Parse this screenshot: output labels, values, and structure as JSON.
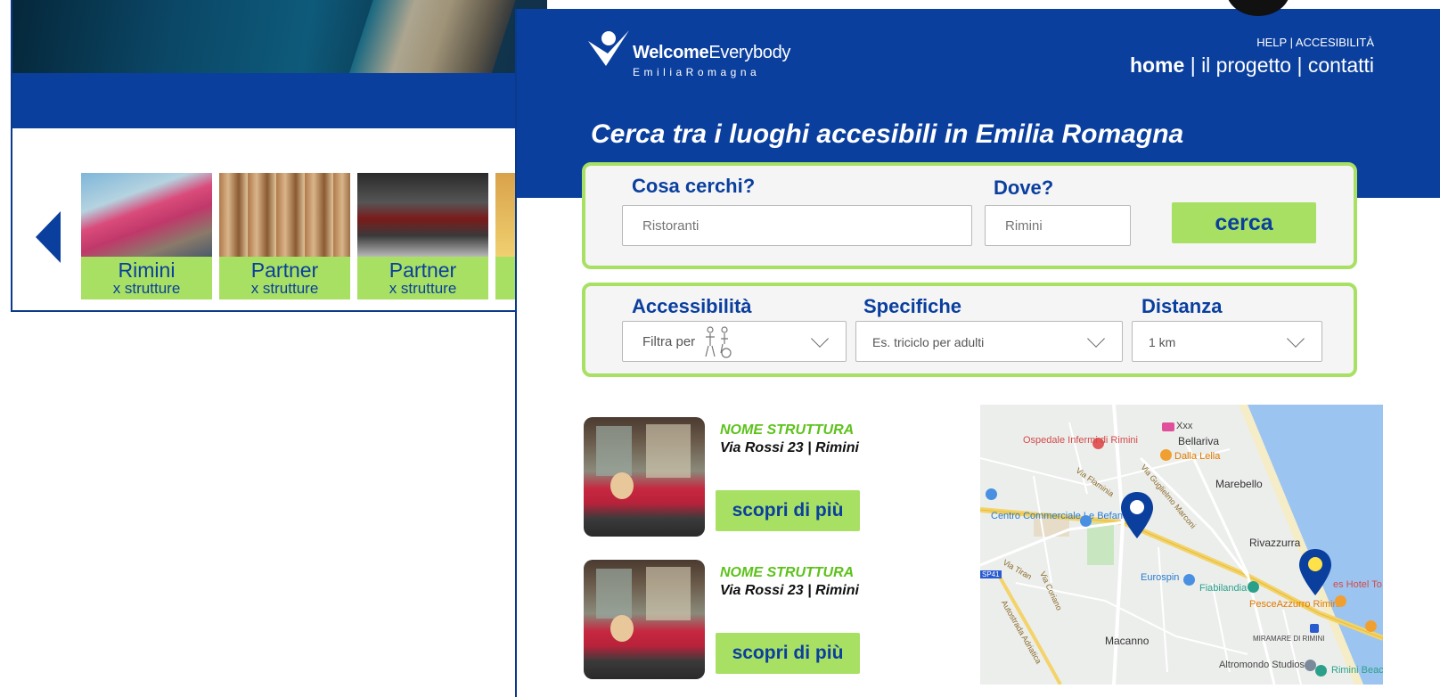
{
  "back_page": {
    "cards": [
      {
        "title": "Rimini",
        "subtitle": "x strutture"
      },
      {
        "title": "Partner",
        "subtitle": "x strutture"
      },
      {
        "title": "Partner",
        "subtitle": "x strutture"
      }
    ]
  },
  "header": {
    "logo": {
      "name_bold": "Welcome",
      "name_rest": "Everybody",
      "region": "EmiliaRomagna"
    },
    "help_links": "HELP | ACCESIBILITÀ",
    "nav": {
      "home": "home",
      "sep": "|",
      "progetto": "il progetto",
      "contatti": "contatti"
    },
    "headline": "Cerca tra i luoghi accesibili in Emilia Romagna"
  },
  "search": {
    "what_label": "Cosa cerchi?",
    "what_placeholder": "Ristoranti",
    "where_label": "Dove?",
    "where_placeholder": "Rimini",
    "button": "cerca"
  },
  "filters": {
    "accessibility_label": "Accessibilità",
    "accessibility_value": "Filtra per",
    "specs_label": "Specifiche",
    "specs_value": "Es. triciclo per adulti",
    "distance_label": "Distanza",
    "distance_value": "1 km"
  },
  "results": [
    {
      "name": "NOME STRUTTURA",
      "address": "Via Rossi 23 | Rimini",
      "button": "scopri di più"
    },
    {
      "name": "NOME STRUTTURA",
      "address": "Via Rossi 23 | Rimini",
      "button": "scopri di più"
    }
  ],
  "map": {
    "labels": {
      "ospedale": "Ospedale Infermi di Rimini",
      "xxx": "Xxx",
      "bellariva": "Bellariva",
      "dalla_lella": "Dalla Lella",
      "marebello": "Marebello",
      "centro": "Centro Commerciale Le Befane",
      "rivazzurra": "Rivazzurra",
      "eurospin": "Eurospin",
      "fiabilandia": "Fiabilandia",
      "hotel": "es Hotel To",
      "pesce": "PesceAzzurro Rimini",
      "miramare": "MIRAMARE DI RIMINI",
      "macanno": "Macanno",
      "altromondo": "Altromondo Studios",
      "rimini_beach": "Rimini Beach",
      "road_flaminia": "Via Flaminia",
      "road_montefeltro": "Via Guglielmo Marconi",
      "road_tiran": "Via Tiran",
      "road_coriano": "Via Coriano",
      "road_autostrada": "Autostrada Adriatica",
      "road_sp": "SP41"
    }
  },
  "colors": {
    "brand_blue": "#0a3f9e",
    "accent_green": "#a8e063",
    "name_green": "#5cc21a"
  }
}
